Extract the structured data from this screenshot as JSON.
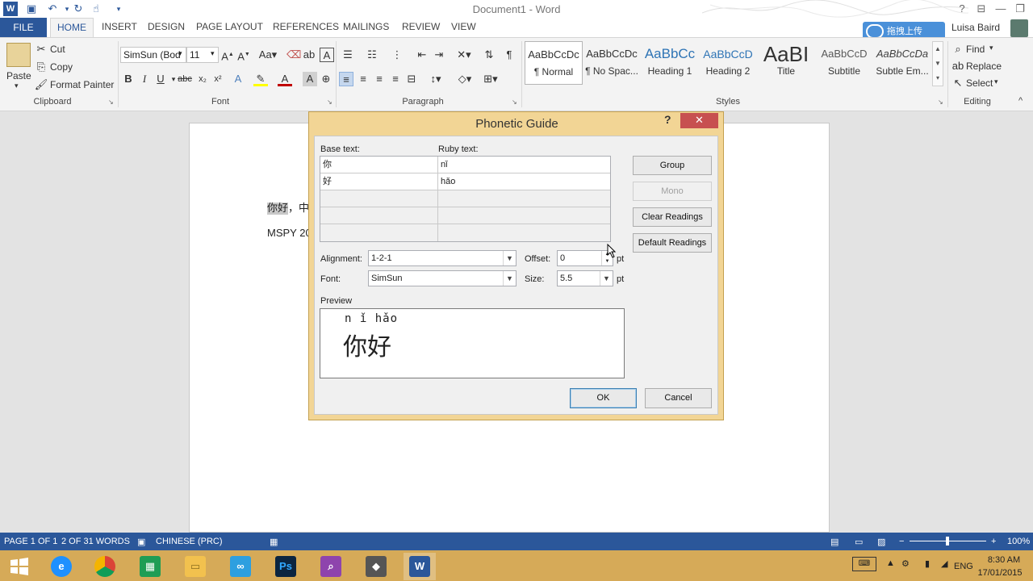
{
  "window": {
    "title": "Document1 - Word",
    "user": "Luisa Baird",
    "upload_label": "拖拽上传"
  },
  "tabs": [
    "FILE",
    "HOME",
    "INSERT",
    "DESIGN",
    "PAGE LAYOUT",
    "REFERENCES",
    "MAILINGS",
    "REVIEW",
    "VIEW"
  ],
  "ribbon": {
    "clipboard": {
      "paste": "Paste",
      "cut": "Cut",
      "copy": "Copy",
      "format_painter": "Format Painter",
      "label": "Clipboard"
    },
    "font": {
      "font_name": "SimSun (Bod",
      "font_size": "11",
      "label": "Font"
    },
    "paragraph": {
      "label": "Paragraph"
    },
    "styles": {
      "label": "Styles",
      "items": [
        {
          "preview": "AaBbCcDc",
          "name": "¶ Normal"
        },
        {
          "preview": "AaBbCcDc",
          "name": "¶ No Spac..."
        },
        {
          "preview": "AaBbCc",
          "name": "Heading 1"
        },
        {
          "preview": "AaBbCcD",
          "name": "Heading 2"
        },
        {
          "preview": "AaBI",
          "name": "Title"
        },
        {
          "preview": "AaBbCcD",
          "name": "Subtitle"
        },
        {
          "preview": "AaBbCcDa",
          "name": "Subtle Em..."
        }
      ]
    },
    "editing": {
      "find": "Find",
      "replace": "Replace",
      "select": "Select",
      "label": "Editing"
    }
  },
  "document": {
    "line1": "你好，中",
    "line2": "MSPY 20"
  },
  "dialog": {
    "title": "Phonetic Guide",
    "help": "?",
    "base_text_label": "Base text:",
    "ruby_text_label": "Ruby text:",
    "rows": [
      {
        "base": "你",
        "ruby": "nǐ"
      },
      {
        "base": "好",
        "ruby": "hǎo"
      }
    ],
    "buttons": {
      "group": "Group",
      "mono": "Mono",
      "clear": "Clear Readings",
      "default": "Default Readings",
      "ok": "OK",
      "cancel": "Cancel"
    },
    "alignment_label": "Alignment:",
    "alignment_value": "1-2-1",
    "offset_label": "Offset:",
    "offset_value": "0",
    "offset_unit": "pt",
    "font_label": "Font:",
    "font_value": "SimSun",
    "size_label": "Size:",
    "size_value": "5.5",
    "size_unit": "pt",
    "preview_label": "Preview",
    "preview_ruby": "n ǐ hǎo",
    "preview_base": "你好"
  },
  "statusbar": {
    "page": "PAGE 1 OF 1",
    "words": "2 OF 31 WORDS",
    "language": "CHINESE (PRC)",
    "zoom": "100%"
  },
  "taskbar": {
    "time": "8:30 AM",
    "date": "17/01/2015",
    "lang": "ENG"
  }
}
